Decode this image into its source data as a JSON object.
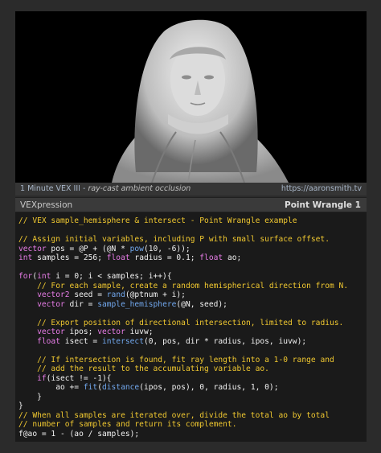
{
  "caption": {
    "series": "1 Minute VEX III",
    "separator": " - ",
    "topic": "ray-cast ambient occlusion",
    "url": "https://aaronsmith.tv"
  },
  "panel": {
    "left_label": "VEXpression",
    "right_label": "Point Wrangle 1"
  },
  "render_image": "marble bust sculpture render with ambient occlusion",
  "code_lines": [
    "// VEX sample_hemisphere & intersect - Point Wrangle example",
    "",
    "// Assign initial variables, including P with small surface offset.",
    "vector pos = @P + (@N * pow(10, -6));",
    "int samples = 256; float radius = 0.1; float ao;",
    "",
    "for(int i = 0; i < samples; i++){",
    "    // For each sample, create a random hemispherical direction from N.",
    "    vector2 seed = rand(@ptnum + i);",
    "    vector dir = sample_hemisphere(@N, seed);",
    "",
    "    // Export position of directional intersection, limited to radius.",
    "    vector ipos; vector iuvw;",
    "    float isect = intersect(0, pos, dir * radius, ipos, iuvw);",
    "",
    "    // If intersection is found, fit ray length into a 1-0 range and",
    "    // add the result to the accumulating variable ao.",
    "    if(isect != -1){",
    "        ao += fit(distance(ipos, pos), 0, radius, 1, 0);",
    "    }",
    "}",
    "// When all samples are iterated over, divide the total ao by total",
    "// number of samples and return its complement.",
    "f@ao = 1 - (ao / samples);"
  ]
}
